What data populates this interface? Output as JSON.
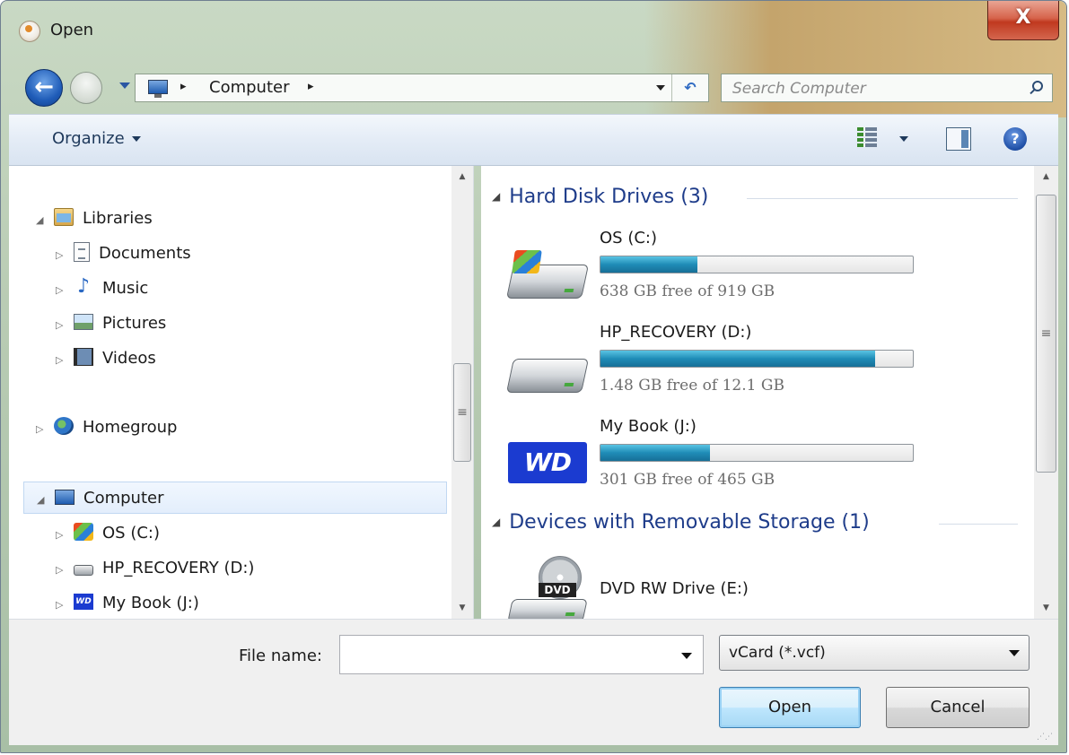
{
  "window": {
    "title": "Open",
    "close_glyph": "X"
  },
  "address_bar": {
    "path_label": "Computer",
    "separator": "▸",
    "refresh_glyph": "↶"
  },
  "search": {
    "placeholder": "Search Computer"
  },
  "toolbar": {
    "organize_label": "Organize",
    "help_glyph": "?"
  },
  "nav_pane": {
    "items": [
      {
        "label": "Libraries",
        "icon": "libraries-icon",
        "arrow": "◢",
        "level": 0
      },
      {
        "label": "Documents",
        "icon": "documents-icon",
        "arrow": "▷",
        "level": 1
      },
      {
        "label": "Music",
        "icon": "music-icon",
        "arrow": "▷",
        "level": 1
      },
      {
        "label": "Pictures",
        "icon": "pictures-icon",
        "arrow": "▷",
        "level": 1
      },
      {
        "label": "Videos",
        "icon": "videos-icon",
        "arrow": "▷",
        "level": 1
      },
      {
        "label": "Homegroup",
        "icon": "homegroup-icon",
        "arrow": "▷",
        "level": 0
      },
      {
        "label": "Computer",
        "icon": "computer-icon",
        "arrow": "◢",
        "level": 0,
        "selected": true
      },
      {
        "label": "OS (C:)",
        "icon": "os-drive-icon",
        "arrow": "▷",
        "level": 1
      },
      {
        "label": "HP_RECOVERY (D:)",
        "icon": "hdd-icon",
        "arrow": "▷",
        "level": 1
      },
      {
        "label": "My Book (J:)",
        "icon": "wd-drive-icon",
        "arrow": "▷",
        "level": 1,
        "wd_text": "WD"
      }
    ]
  },
  "content": {
    "groups": [
      {
        "header": "Hard Disk Drives (3)",
        "drives": [
          {
            "name": "OS (C:)",
            "free_text": "638 GB free of 919 GB",
            "used_fraction": 0.31,
            "icon": "windows-hdd-icon"
          },
          {
            "name": "HP_RECOVERY (D:)",
            "free_text": "1.48 GB free of 12.1 GB",
            "used_fraction": 0.88,
            "icon": "hdd-icon"
          },
          {
            "name": "My Book (J:)",
            "free_text": "301 GB free of 465 GB",
            "used_fraction": 0.35,
            "icon": "wd-icon",
            "wd_text": "WD"
          }
        ]
      },
      {
        "header": "Devices with Removable Storage (1)",
        "drives": [
          {
            "name": "DVD RW Drive (E:)",
            "icon": "dvd-drive-icon",
            "dvd_text": "DVD"
          }
        ]
      }
    ]
  },
  "footer": {
    "file_name_label": "File name:",
    "file_name_value": "",
    "file_type_value": "vCard (*.vcf)",
    "open_label": "Open",
    "cancel_label": "Cancel"
  },
  "colors": {
    "accent": "#1e3c8a",
    "progress": "#1f8cb7"
  }
}
